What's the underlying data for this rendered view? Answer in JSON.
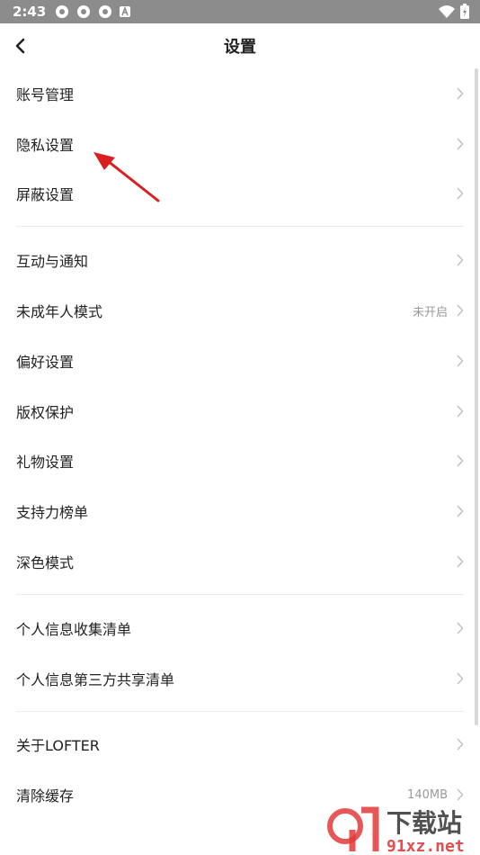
{
  "status_bar": {
    "time": "2:43"
  },
  "nav": {
    "title": "设置"
  },
  "groups": [
    [
      {
        "label": "账号管理"
      },
      {
        "label": "隐私设置"
      },
      {
        "label": "屏蔽设置"
      }
    ],
    [
      {
        "label": "互动与通知"
      },
      {
        "label": "未成年人模式",
        "value": "未开启"
      },
      {
        "label": "偏好设置"
      },
      {
        "label": "版权保护"
      },
      {
        "label": "礼物设置"
      },
      {
        "label": "支持力榜单"
      },
      {
        "label": "深色模式"
      }
    ],
    [
      {
        "label": "个人信息收集清单"
      },
      {
        "label": "个人信息第三方共享清单"
      }
    ],
    [
      {
        "label": "关于LOFTER"
      },
      {
        "label": "清除缓存",
        "value": "140MB"
      }
    ]
  ],
  "watermark": {
    "brand": "下载站",
    "site": "91xz.net"
  },
  "colors": {
    "status_bar": "#8c8c8c",
    "annotation_arrow": "#d91f1f",
    "watermark_red": "#e23a3a"
  },
  "icons": [
    "back-arrow-icon",
    "chevron-right-icon",
    "wifi-icon",
    "battery-icon"
  ]
}
